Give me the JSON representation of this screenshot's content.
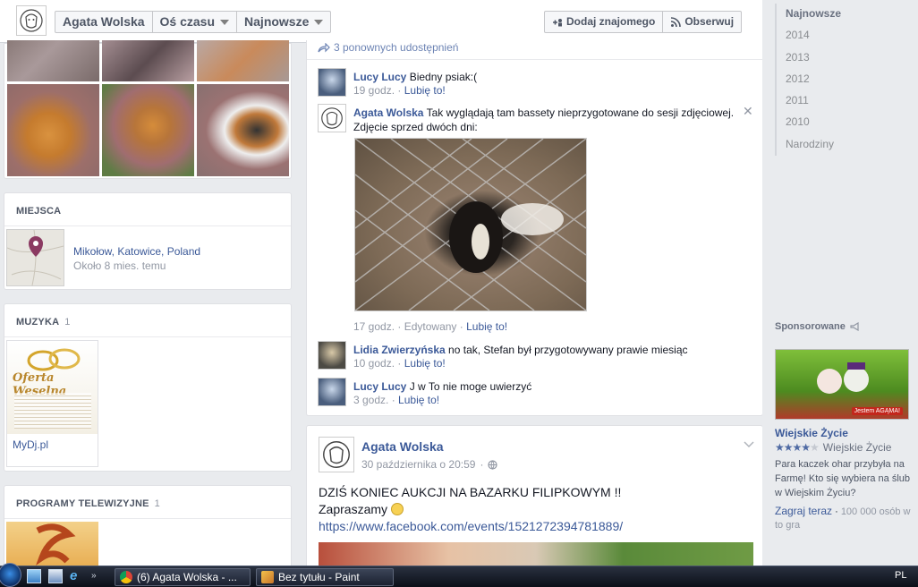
{
  "colors": {
    "link": "#3b5998",
    "muted": "#9197a3",
    "bg": "#e9ebee"
  },
  "topbar": {
    "name": "Agata Wolska",
    "timeline": "Oś czasu",
    "sort": "Najnowsze",
    "add_friend": "Dodaj znajomego",
    "follow": "Obserwuj"
  },
  "left": {
    "places": {
      "title": "MIEJSCA",
      "location": "Mikołow, Katowice, Poland",
      "time": "Około 8 mies. temu"
    },
    "music": {
      "title": "MUZYKA",
      "count": "1",
      "item": "MyDj.pl",
      "cover_text": "Oferta Weselna"
    },
    "tv": {
      "title": "PROGRAMY TELEWIZYJNE",
      "count": "1"
    }
  },
  "post1": {
    "shares": "3 ponownych udostępnień",
    "comments": [
      {
        "name": "Lucy Lucy",
        "text": "Biedny psiak:(",
        "time": "19 godz.",
        "like": "Lubię to!"
      },
      {
        "name": "Agata Wolska",
        "text": "Tak wyglądają tam bassety nieprzygotowane do sesji zdjęciowej. Zdjęcie sprzed dwóch dni:",
        "time": "17 godz.",
        "edited": "Edytowany",
        "like": "Lubię to!"
      },
      {
        "name": "Lidia Zwierzyńska",
        "text": "no tak, Stefan był przygotowywany prawie miesiąc",
        "time": "10 godz.",
        "like": "Lubię to!"
      },
      {
        "name": "Lucy Lucy",
        "text": "J w To nie moge uwierzyć",
        "time": "3 godz.",
        "like": "Lubię to!"
      }
    ]
  },
  "post2": {
    "author": "Agata Wolska",
    "date": "30 października o 20:59",
    "line1": "DZIŚ KONIEC AUKCJI NA BAZARKU FILIPKOWYM !!",
    "line2": "Zapraszamy",
    "link": "https://www.facebook.com/events/1521272394781889/"
  },
  "right": {
    "years": [
      "Najnowsze",
      "2014",
      "2013",
      "2012",
      "2011",
      "2010",
      "Narodziny"
    ],
    "sponsored_title": "Sponsorowane",
    "ad": {
      "image_text": "Jestem AGĄMA!",
      "title": "Wiejskie Życie",
      "rating_label": "Wiejskie Życie",
      "rating_value": 4,
      "body": "Para kaczek ohar przybyła na Farmę! Kto się wybiera na ślub w Wiejskim Życiu?",
      "cta": "Zagraj teraz",
      "users": "100 000 osób w to gra"
    }
  },
  "taskbar": {
    "tasks": [
      "(6) Agata Wolska - ...",
      "Bez tytułu - Paint"
    ],
    "lang": "PL"
  }
}
